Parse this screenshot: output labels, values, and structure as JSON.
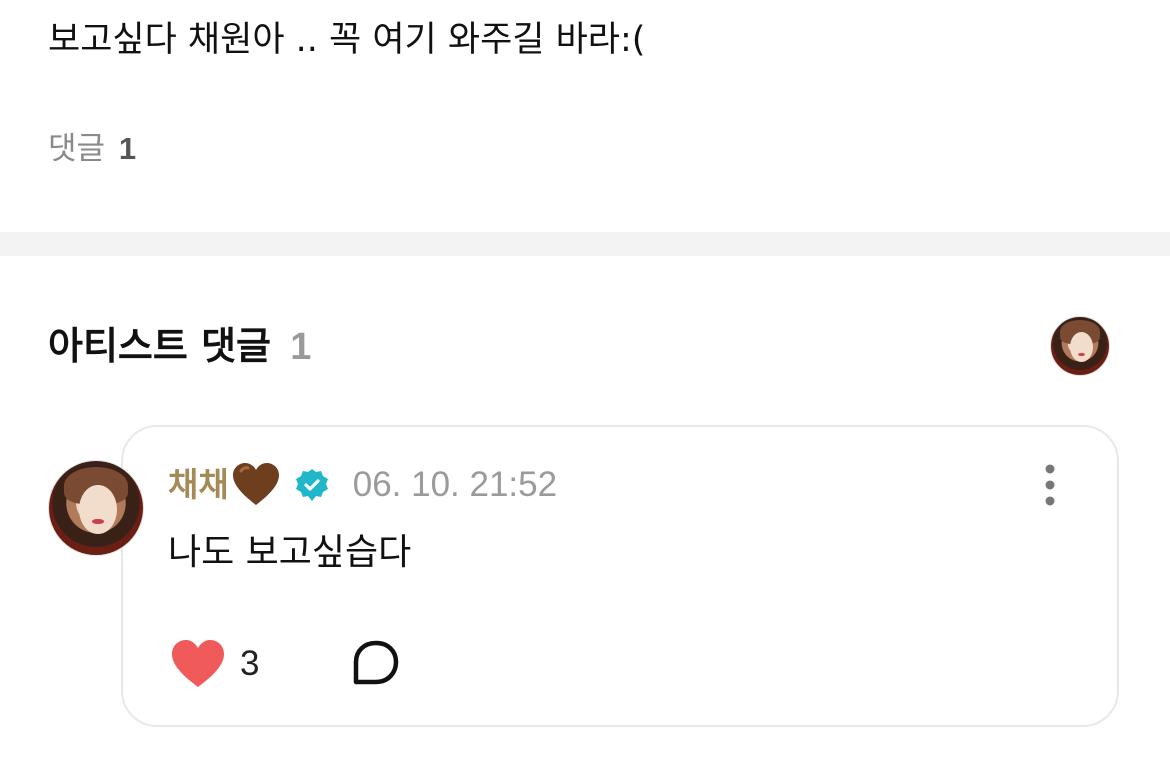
{
  "post": {
    "text": "보고싶다 채원아 .. 꼭 여기 와주길 바라:("
  },
  "comments_summary": {
    "label": "댓글",
    "count": "1"
  },
  "artist_section": {
    "title": "아티스트 댓글",
    "count": "1"
  },
  "comment": {
    "author": "채채",
    "author_emoji": "brown-heart-icon",
    "verified": true,
    "timestamp": "06. 10. 21:52",
    "text": "나도 보고싶습다",
    "likes": "3"
  },
  "colors": {
    "author_name": "#a58a56",
    "verified_badge": "#1fb7c9",
    "like_heart": "#f05a5a",
    "divider": "#f3f3f3",
    "card_border": "#e8e8e8"
  },
  "icons": {
    "more": "more-vertical-icon",
    "like": "heart-icon",
    "reply": "speech-bubble-icon",
    "verified": "verified-badge-icon"
  }
}
